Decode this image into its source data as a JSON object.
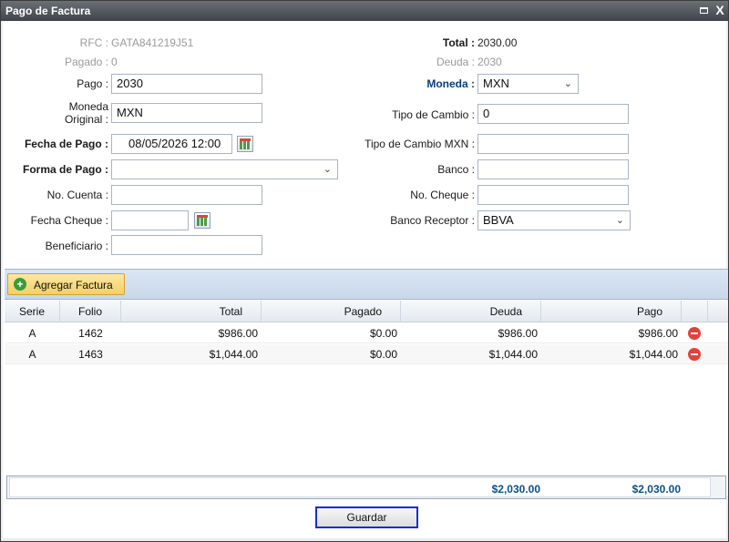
{
  "window": {
    "title": "Pago de Factura",
    "max_icon": "maximize-icon",
    "close_icon": "close-icon",
    "close_glyph": "X"
  },
  "form": {
    "rfc_label": "RFC :",
    "rfc_value": "GATA841219J51",
    "pagado_label": "Pagado :",
    "pagado_value": "0",
    "pago_label": "Pago :",
    "pago_value": "2030",
    "moneda_original_label_1": "Moneda",
    "moneda_original_label_2": "Original :",
    "moneda_original_value": "MXN",
    "fecha_pago_label": "Fecha de Pago :",
    "fecha_pago_value": "08/05/2026 12:00",
    "forma_pago_label": "Forma de Pago :",
    "forma_pago_value": "",
    "no_cuenta_label": "No. Cuenta :",
    "no_cuenta_value": "",
    "fecha_cheque_label": "Fecha Cheque :",
    "fecha_cheque_value": "",
    "beneficiario_label": "Beneficiario :",
    "beneficiario_value": "",
    "total_label": "Total :",
    "total_value": "2030.00",
    "deuda_label": "Deuda :",
    "deuda_value": "2030",
    "moneda_label": "Moneda :",
    "moneda_value": "MXN",
    "tipo_cambio_label": "Tipo de Cambio :",
    "tipo_cambio_value": "0",
    "tipo_cambio_mxn_label": "Tipo de Cambio MXN :",
    "tipo_cambio_mxn_value": "",
    "banco_label": "Banco :",
    "banco_value": "",
    "no_cheque_label": "No. Cheque :",
    "no_cheque_value": "",
    "banco_receptor_label": "Banco Receptor :",
    "banco_receptor_value": "BBVA"
  },
  "toolbar": {
    "add_label": "Agregar Factura",
    "add_icon": "add-circle-icon"
  },
  "grid": {
    "columns": [
      "Serie",
      "Folio",
      "Total",
      "Pagado",
      "Deuda",
      "Pago"
    ],
    "rows": [
      {
        "serie": "A",
        "folio": "1462",
        "total": "$986.00",
        "pagado": "$0.00",
        "deuda": "$986.00",
        "pago": "$986.00"
      },
      {
        "serie": "A",
        "folio": "1463",
        "total": "$1,044.00",
        "pagado": "$0.00",
        "deuda": "$1,044.00",
        "pago": "$1,044.00"
      }
    ],
    "summary_deuda": "$2,030.00",
    "summary_pago": "$2,030.00",
    "remove_icon": "remove-circle-icon"
  },
  "footer": {
    "save_label": "Guardar"
  },
  "colors": {
    "accent_label": "#0b3d7a",
    "save_border": "#1a2ecf",
    "remove": "#e2423a",
    "add_button": "#f4cf63"
  }
}
